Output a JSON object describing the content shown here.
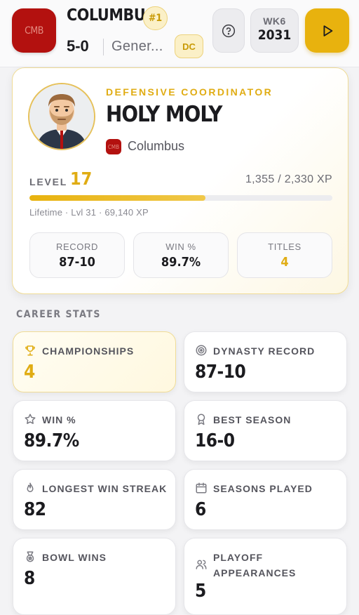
{
  "header": {
    "team_abbr": "CMB",
    "team_name": "COLUMBUS",
    "rank": "#1",
    "record": "5-0",
    "subtitle": "Gener...",
    "role_badge": "DC",
    "week": "WK6",
    "year": "2031",
    "icons": {
      "help": "help-circle-icon",
      "play": "play-icon"
    }
  },
  "profile": {
    "role": "DEFENSIVE COORDINATOR",
    "name": "HOLY MOLY",
    "team_abbr": "CMB",
    "team": "Columbus",
    "level_label": "LEVEL",
    "level": "17",
    "xp": "1,355 / 2,330 XP",
    "xp_progress": 0.58,
    "lifetime": "Lifetime · Lvl 31 · 69,140 XP",
    "stats": [
      {
        "label": "RECORD",
        "value": "87-10",
        "gold": false
      },
      {
        "label": "WIN %",
        "value": "89.7%",
        "gold": false
      },
      {
        "label": "TITLES",
        "value": "4",
        "gold": true
      }
    ]
  },
  "career": {
    "title": "CAREER STATS",
    "items": [
      {
        "label": "CHAMPIONSHIPS",
        "value": "4",
        "icon": "trophy-icon",
        "highlight": true
      },
      {
        "label": "DYNASTY RECORD",
        "value": "87-10",
        "icon": "target-icon",
        "highlight": false
      },
      {
        "label": "WIN %",
        "value": "89.7%",
        "icon": "star-icon",
        "highlight": false
      },
      {
        "label": "BEST SEASON",
        "value": "16-0",
        "icon": "award-icon",
        "highlight": false
      },
      {
        "label": "LONGEST WIN STREAK",
        "value": "82",
        "icon": "flame-icon",
        "highlight": false
      },
      {
        "label": "SEASONS PLAYED",
        "value": "6",
        "icon": "calendar-icon",
        "highlight": false
      },
      {
        "label": "BOWL WINS",
        "value": "8",
        "icon": "medal-icon",
        "highlight": false
      },
      {
        "label": "PLAYOFF APPEARANCES",
        "value": "5",
        "icon": "users-icon",
        "highlight": false
      }
    ]
  },
  "colors": {
    "accent": "#e8b20e",
    "team_primary": "#b3110f",
    "background": "#f3f3f5"
  }
}
